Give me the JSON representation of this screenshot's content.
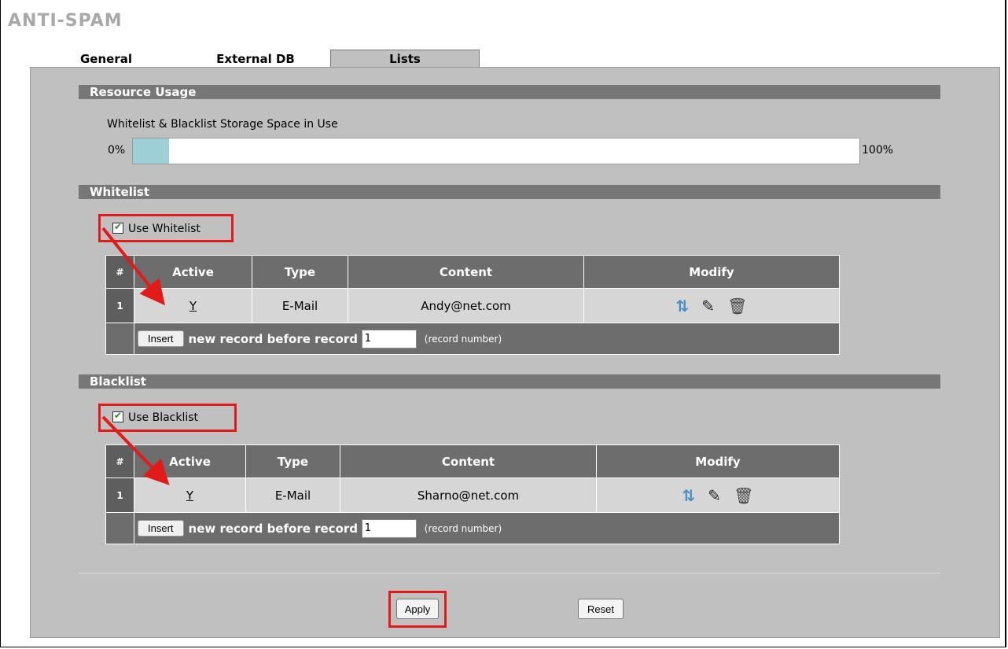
{
  "page": {
    "title": "ANTI-SPAM"
  },
  "tabs": [
    {
      "label": "General",
      "active": false
    },
    {
      "label": "External DB",
      "active": false
    },
    {
      "label": "Lists",
      "active": true
    }
  ],
  "resource_usage": {
    "section_title": "Resource Usage",
    "label": "Whitelist & Blacklist Storage Space in Use",
    "min_label": "0%",
    "max_label": "100%",
    "value_label": "5%",
    "value_fraction": 0.05,
    "fill_color": "#9fcfd6"
  },
  "whitelist": {
    "section_title": "Whitelist",
    "use_label": "Use Whitelist",
    "checked": true,
    "columns": [
      "#",
      "Active",
      "Type",
      "Content",
      "Modify"
    ],
    "rows": [
      {
        "num": "1",
        "active": "Y",
        "type": "E-Mail",
        "content": "Andy@net.com"
      }
    ],
    "insert": {
      "button_label": "Insert",
      "text": "new record before record",
      "record_value": "1",
      "hint": "(record number)"
    }
  },
  "blacklist": {
    "section_title": "Blacklist",
    "use_label": "Use Blacklist",
    "checked": true,
    "columns": [
      "#",
      "Active",
      "Type",
      "Content",
      "Modify"
    ],
    "rows": [
      {
        "num": "1",
        "active": "Y",
        "type": "E-Mail",
        "content": "Sharno@net.com"
      }
    ],
    "insert": {
      "button_label": "Insert",
      "text": "new record before record",
      "record_value": "1",
      "hint": "(record number)"
    }
  },
  "buttons": {
    "apply": "Apply",
    "reset": "Reset"
  },
  "icons": {
    "move": "move-icon",
    "edit": "edit-icon",
    "delete": "trash-icon"
  },
  "colors": {
    "annotation": "#e21a1a",
    "section_bar": "#777777",
    "panel": "#c0c0c0"
  }
}
